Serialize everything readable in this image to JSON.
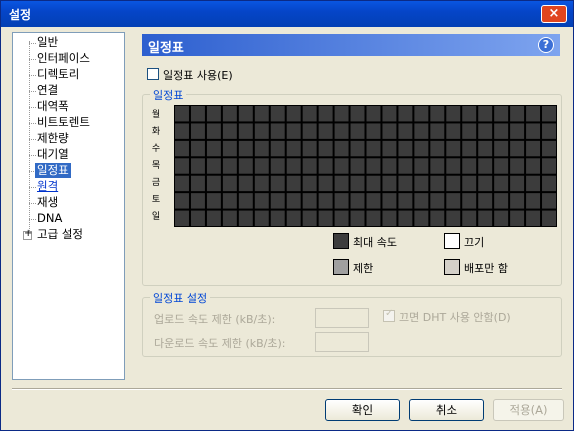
{
  "window": {
    "title": "설정",
    "close_symbol": "×"
  },
  "nav": {
    "items": [
      {
        "label": "일반"
      },
      {
        "label": "인터페이스"
      },
      {
        "label": "디렉토리"
      },
      {
        "label": "연결"
      },
      {
        "label": "대역폭"
      },
      {
        "label": "비트토렌트"
      },
      {
        "label": "제한량"
      },
      {
        "label": "대기열"
      },
      {
        "label": "일정표",
        "selected": true
      },
      {
        "label": "원격",
        "link": true
      },
      {
        "label": "재생"
      },
      {
        "label": "DNA"
      },
      {
        "label": "고급 설정",
        "expandable": true
      }
    ],
    "expand_symbol": "+"
  },
  "header": {
    "title": "일정표",
    "help_symbol": "?"
  },
  "schedule_enable": {
    "label": "일정표 사용(E)",
    "checked": false
  },
  "schedule_group": {
    "legend": "일정표",
    "days": [
      "월",
      "화",
      "수",
      "목",
      "금",
      "토",
      "일"
    ],
    "hours": 24,
    "legend_items": [
      {
        "label": "최대 속도",
        "color": "#3c3c3c"
      },
      {
        "label": "끄기",
        "color": "#ffffff"
      },
      {
        "label": "제한",
        "color": "#a0a0a0"
      },
      {
        "label": "배포만 함",
        "color": "#d4d0c8"
      }
    ],
    "cell_color": "#3c3c3c"
  },
  "settings_group": {
    "legend": "일정표 설정",
    "upload_label": "업로드 속도 제한 (kB/초):",
    "download_label": "다운로드 속도 제한 (kB/초):",
    "upload_value": "",
    "download_value": "",
    "dht_label": "끄면 DHT 사용 안함(D)",
    "dht_checked": true
  },
  "buttons": {
    "ok": "확인",
    "cancel": "취소",
    "apply": "적용(A)"
  }
}
